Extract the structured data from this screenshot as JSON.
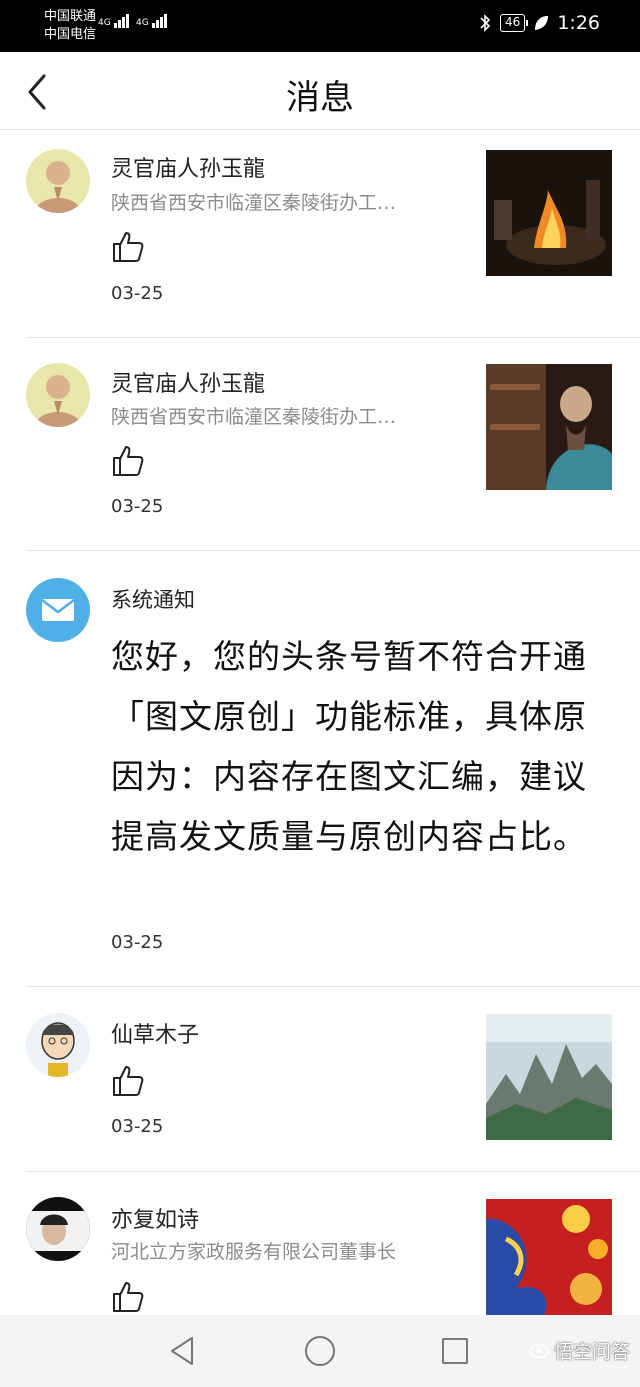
{
  "status_bar": {
    "carrier_1": "中国联通",
    "carrier_2": "中国电信",
    "net_1": "4G",
    "net_2": "4G",
    "battery": "46",
    "time": "1:26"
  },
  "header": {
    "title": "消息"
  },
  "messages": [
    {
      "type": "like",
      "name": "灵官庙人孙玉龍",
      "subtitle": "陕西省西安市临潼区秦陵街办工…",
      "date": "03-25",
      "thumb": "campfire-photo"
    },
    {
      "type": "like",
      "name": "灵官庙人孙玉龍",
      "subtitle": "陕西省西安市临潼区秦陵街办工…",
      "date": "03-25",
      "thumb": "figurine-photo"
    },
    {
      "type": "system",
      "name": "系统通知",
      "body": "您好，您的头条号暂不符合开通「图文原创」功能标准，具体原因为：内容存在图文汇编，建议提高发文质量与原创内容占比。",
      "date": "03-25"
    },
    {
      "type": "like",
      "name": "仙草木子",
      "subtitle": "",
      "date": "03-25",
      "thumb": "mountain-photo"
    },
    {
      "type": "like",
      "name": "亦复如诗",
      "subtitle": "河北立方家政服务有限公司董事长",
      "date": "",
      "thumb": "dragon-photo"
    }
  ],
  "watermark": "悟空问答",
  "colors": {
    "mail_icon_bg": "#4fb0e8",
    "divider": "#e6e6e6",
    "subtitle_text": "#8c8c8c"
  }
}
